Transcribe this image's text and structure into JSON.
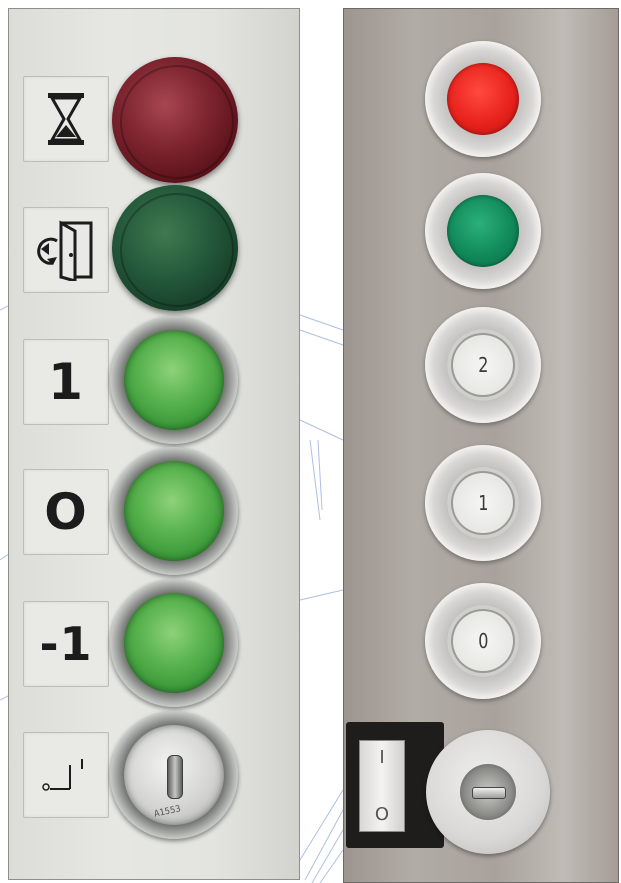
{
  "left_panel": {
    "labels": [
      {
        "icon": "hourglass-icon",
        "text": ""
      },
      {
        "icon": "door-open-icon",
        "text": ""
      },
      {
        "icon": "",
        "text": "1"
      },
      {
        "icon": "",
        "text": "O"
      },
      {
        "icon": "",
        "text": "-1"
      },
      {
        "icon": "switch-symbol-icon",
        "text": ""
      }
    ],
    "lamps": [
      {
        "color": "#7e2530",
        "name": "red"
      },
      {
        "color": "#23573a",
        "name": "green"
      }
    ],
    "buttons_color": "#5cb550",
    "key_engraving": "A1553"
  },
  "right_panel": {
    "indicator_colors": {
      "red": "#e8221c",
      "green": "#11895a"
    },
    "floor_buttons": [
      "2",
      "1",
      "0"
    ],
    "rocker_switch": {
      "top": "I",
      "bottom": "O"
    }
  }
}
